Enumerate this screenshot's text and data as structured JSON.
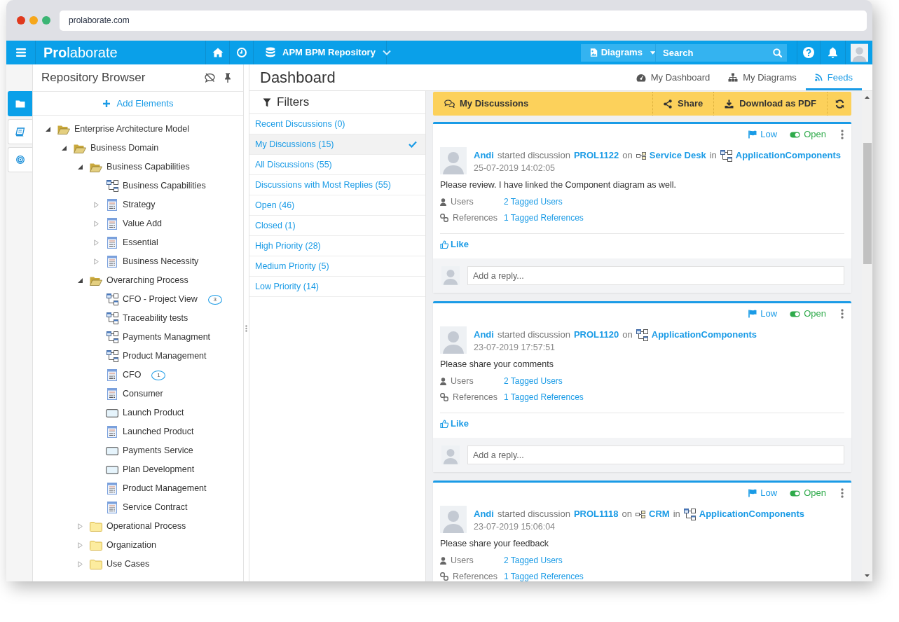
{
  "browser": {
    "address": "prolaborate.com"
  },
  "app_bar": {
    "logo": "**Pro**laborate",
    "repository": "APM BPM Repository",
    "diagrams_menu": "Diagrams",
    "search": {
      "placeholder": "Search"
    }
  },
  "side_rail": {
    "tabs": [
      {
        "selected": true
      },
      {
        "selected": false
      },
      {
        "selected": false
      }
    ]
  },
  "repository_browser": {
    "title": "Repository Browser",
    "add_button": "Add Elements",
    "tree": [
      {
        "label": "Enterprise Architecture Model",
        "kind": "folder",
        "expanded": true,
        "children": [
          {
            "label": "Business Domain",
            "kind": "folder",
            "expanded": true,
            "children": [
              {
                "label": "Business Capabilities",
                "kind": "folder",
                "expanded": true,
                "children": [
                  {
                    "label": "Business Capabilities",
                    "kind": "diagram"
                  },
                  {
                    "label": "Strategy",
                    "kind": "class",
                    "expanded": false
                  },
                  {
                    "label": "Value Add",
                    "kind": "class",
                    "expanded": false
                  },
                  {
                    "label": "Essential",
                    "kind": "class",
                    "expanded": false
                  },
                  {
                    "label": "Business Necessity",
                    "kind": "class",
                    "expanded": false
                  }
                ]
              },
              {
                "label": "Overarching Process",
                "kind": "folder",
                "expanded": true,
                "children": [
                  {
                    "label": "CFO - Project View",
                    "kind": "diagram",
                    "comments": "3"
                  },
                  {
                    "label": "Traceability tests",
                    "kind": "diagram"
                  },
                  {
                    "label": "Payments Managment",
                    "kind": "diagram"
                  },
                  {
                    "label": "Product Management",
                    "kind": "diagram"
                  },
                  {
                    "label": "CFO",
                    "kind": "class",
                    "comments": "1"
                  },
                  {
                    "label": "Consumer",
                    "kind": "class"
                  },
                  {
                    "label": "Launch Product",
                    "kind": "activity"
                  },
                  {
                    "label": "Launched Product",
                    "kind": "class"
                  },
                  {
                    "label": "Payments Service",
                    "kind": "activity"
                  },
                  {
                    "label": "Plan Development",
                    "kind": "activity"
                  },
                  {
                    "label": "Product Management",
                    "kind": "class"
                  },
                  {
                    "label": "Service Contract",
                    "kind": "class"
                  }
                ]
              },
              {
                "label": "Operational Process",
                "kind": "folder",
                "expanded": false
              },
              {
                "label": "Organization",
                "kind": "folder",
                "expanded": false
              },
              {
                "label": "Use Cases",
                "kind": "folder",
                "expanded": false
              }
            ]
          }
        ]
      }
    ]
  },
  "dashboard": {
    "title": "Dashboard",
    "tabs": [
      {
        "label": "My Dashboard",
        "selected": false
      },
      {
        "label": "My Diagrams",
        "selected": false
      },
      {
        "label": "Feeds",
        "selected": true
      }
    ]
  },
  "filters": {
    "title": "Filters",
    "items": [
      {
        "label": "Recent Discussions (0)",
        "selected": false
      },
      {
        "label": "My Discussions (15)",
        "selected": true
      },
      {
        "label": "All Discussions (55)",
        "selected": false
      },
      {
        "label": "Discussions with Most Replies (55)",
        "selected": false
      },
      {
        "label": "Open (46)",
        "selected": false
      },
      {
        "label": "Closed (1)",
        "selected": false
      },
      {
        "label": "High Priority (28)",
        "selected": false
      },
      {
        "label": "Medium Priority (5)",
        "selected": false
      },
      {
        "label": "Low Priority (14)",
        "selected": false
      }
    ]
  },
  "feed": {
    "toolbar": {
      "title": "My Discussions",
      "buttons": [
        "Share",
        "Download as PDF"
      ]
    },
    "discussions": [
      {
        "priority": "Low",
        "status": "Open",
        "author": "Andi",
        "action": "started discussion",
        "id": "PROL1122",
        "targets": [
          {
            "connector": "on",
            "kind": "component",
            "name": "Service Desk"
          },
          {
            "connector": "in",
            "kind": "diagram",
            "name": "ApplicationComponents"
          }
        ],
        "timestamp": "25-07-2019 14:02:05",
        "message": "Please review. I have linked the Component diagram as well.",
        "users": {
          "label": "Users",
          "link": "2 Tagged Users"
        },
        "references": {
          "label": "References",
          "link": "1 Tagged References"
        },
        "like": "Like",
        "reply": {
          "placeholder": "Add a reply..."
        }
      },
      {
        "priority": "Low",
        "status": "Open",
        "author": "Andi",
        "action": "started discussion",
        "id": "PROL1120",
        "targets": [
          {
            "connector": "on",
            "kind": "diagram",
            "name": "ApplicationComponents"
          }
        ],
        "timestamp": "23-07-2019 17:57:51",
        "message": "Please share your comments",
        "users": {
          "label": "Users",
          "link": "2 Tagged Users"
        },
        "references": {
          "label": "References",
          "link": "1 Tagged References"
        },
        "like": "Like",
        "reply": {
          "placeholder": "Add a reply..."
        }
      },
      {
        "priority": "Low",
        "status": "Open",
        "author": "Andi",
        "action": "started discussion",
        "id": "PROL1118",
        "targets": [
          {
            "connector": "on",
            "kind": "component",
            "name": "CRM"
          },
          {
            "connector": "in",
            "kind": "diagram",
            "name": "ApplicationComponents"
          }
        ],
        "timestamp": "23-07-2019 15:06:04",
        "message": "Please share your feedback",
        "users": {
          "label": "Users",
          "link": "2 Tagged Users"
        },
        "references": {
          "label": "References",
          "link": "1 Tagged References"
        }
      }
    ]
  }
}
